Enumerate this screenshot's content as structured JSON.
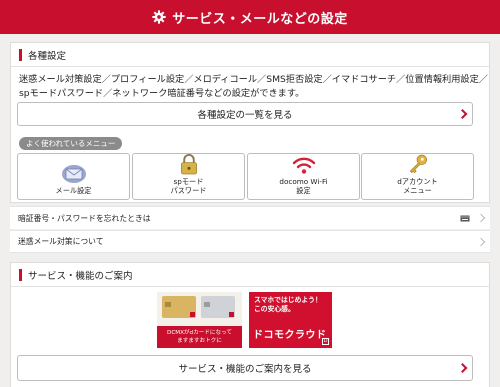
{
  "header": {
    "title": "サービス・メールなどの設定",
    "icon": "gear-icon"
  },
  "settings": {
    "title": "各種設定",
    "description_line1": "迷惑メール対策設定／プロフィール設定／メロディコール／SMS拒否設定／イマドコサーチ／位置情報利用設定／",
    "description_line2": "spモードパスワード／ネットワーク暗証番号などの設定ができます。",
    "list_button": "各種設定の一覧を見る",
    "frequent_label": "よく使われているメニュー",
    "tiles": [
      {
        "label": "メール設定",
        "icon": "mail-icon"
      },
      {
        "label": "spモード\nパスワード",
        "icon": "lock-icon"
      },
      {
        "label": "docomo Wi-Fi\n設定",
        "icon": "wifi-icon"
      },
      {
        "label": "dアカウント\nメニュー",
        "icon": "key-icon"
      }
    ]
  },
  "links": [
    {
      "label": "暗証番号・パスワードを忘れたときは",
      "icon": "keyboard-icon"
    },
    {
      "label": "迷惑メール対策について"
    }
  ],
  "services": {
    "title": "サービス・機能のご案内",
    "banner_dcmx_text1": "DCMXがdカードになって",
    "banner_dcmx_text2": "ますますおトクに",
    "banner_cloud_text1": "スマホではじめよう！",
    "banner_cloud_text2": "この安心感。",
    "banner_cloud_brand": "ドコモクラウド",
    "more_button": "サービス・機能のご案内を見る"
  },
  "colors": {
    "accent": "#c8102e",
    "background": "#f0efed"
  }
}
